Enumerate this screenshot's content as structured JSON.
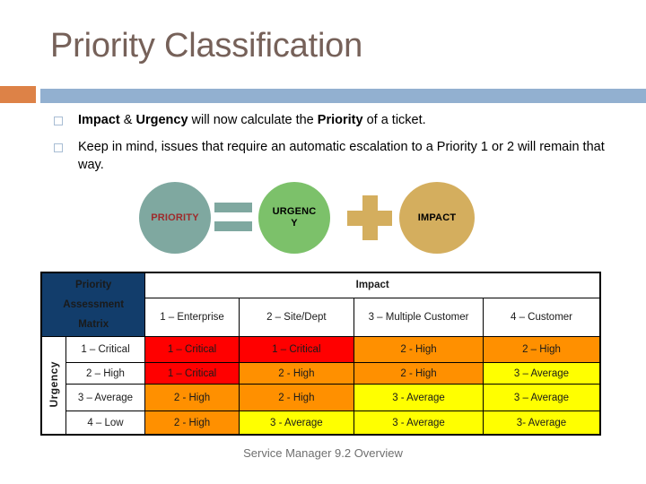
{
  "slide": {
    "title": "Priority Classification",
    "footer": "Service Manager 9.2 Overview"
  },
  "colors": {
    "title_text": "#766159",
    "accent_orange": "#DD8247",
    "accent_blue": "#92B0D0",
    "header_navy": "#123D6B",
    "priority_circle": "#7FA8A0",
    "priority_text": "#9E2A2B",
    "urgency_circle": "#7CC16A",
    "impact_circle": "#D4AE5E",
    "critical_red": "#FF0000",
    "high_orange": "#FF9000",
    "average_yellow": "#FFFF00"
  },
  "bullets": [
    {
      "bold_1": "Impact",
      "mid": " & ",
      "bold_2": "Urgency",
      "norm_1": " will now calculate the ",
      "bold_3": "Priority",
      "norm_2": " of a ticket."
    },
    {
      "text": "Keep in mind, issues that require an automatic escalation to a Priority 1 or 2 will remain that way."
    }
  ],
  "diagram": {
    "priority_label": "PRIORITY",
    "equals_symbol": "=",
    "urgency_label": "URGENCY",
    "plus_symbol": "+",
    "impact_label": "IMPACT"
  },
  "matrix": {
    "corner_title_line1": "Priority",
    "corner_title_line2": "Assessment",
    "corner_title_line3": "Matrix",
    "impact_header": "Impact",
    "urgency_header": "Urgency",
    "impact_columns": [
      "1 – Enterprise",
      "2 – Site/Dept",
      "3 – Multiple Customer",
      "4 – Customer"
    ],
    "urgency_rows": [
      "1 – Critical",
      "2 – High",
      "3 – Average",
      "4 – Low"
    ],
    "cells": [
      [
        {
          "text": "1 – Critical",
          "level": "critical"
        },
        {
          "text": "1 – Critical",
          "level": "critical"
        },
        {
          "text": "2 - High",
          "level": "high"
        },
        {
          "text": "2 – High",
          "level": "high"
        }
      ],
      [
        {
          "text": "1 – Critical",
          "level": "critical"
        },
        {
          "text": "2 - High",
          "level": "high"
        },
        {
          "text": "2 - High",
          "level": "high"
        },
        {
          "text": "3 – Average",
          "level": "average"
        }
      ],
      [
        {
          "text": "2 - High",
          "level": "high"
        },
        {
          "text": "2 - High",
          "level": "high"
        },
        {
          "text": "3 - Average",
          "level": "average"
        },
        {
          "text": "3 – Average",
          "level": "average"
        }
      ],
      [
        {
          "text": "2 - High",
          "level": "high"
        },
        {
          "text": "3 - Average",
          "level": "average"
        },
        {
          "text": "3 - Average",
          "level": "average"
        },
        {
          "text": "3- Average",
          "level": "average"
        }
      ]
    ]
  }
}
